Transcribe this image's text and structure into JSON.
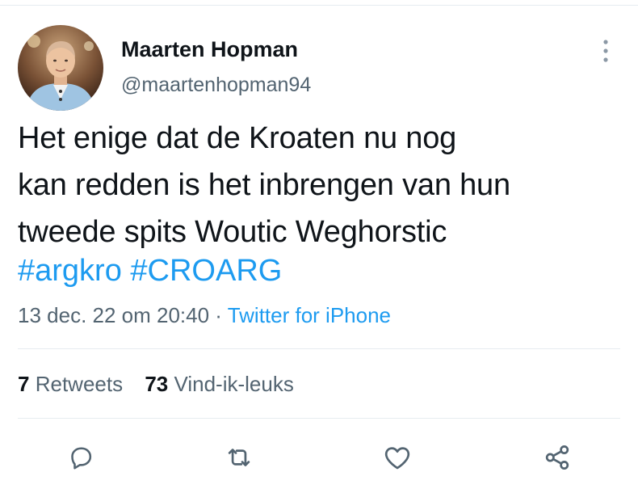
{
  "tweet": {
    "author": {
      "name": "Maarten Hopman",
      "handle": "@maartenhopman94"
    },
    "text_lines": [
      "Het enige dat de Kroaten nu nog",
      "kan redden is het inbrengen van hun",
      "tweede spits Woutic Weghorstic"
    ],
    "hashtags": [
      "#argkro",
      "#CROARG"
    ],
    "timestamp": "13 dec. 22 om 20:40",
    "separator": " · ",
    "source": "Twitter for iPhone",
    "stats": {
      "retweets_count": "7",
      "retweets_label": "Retweets",
      "likes_count": "73",
      "likes_label": "Vind-ik-leuks"
    }
  },
  "icons": {
    "more": "more-vertical-icon",
    "reply": "reply-icon",
    "retweet": "retweet-icon",
    "like": "like-icon",
    "share": "share-icon"
  },
  "colors": {
    "link": "#1d9bf0",
    "secondary_text": "#536471",
    "primary_text": "#0f1419",
    "divider": "#e6ecf0"
  }
}
